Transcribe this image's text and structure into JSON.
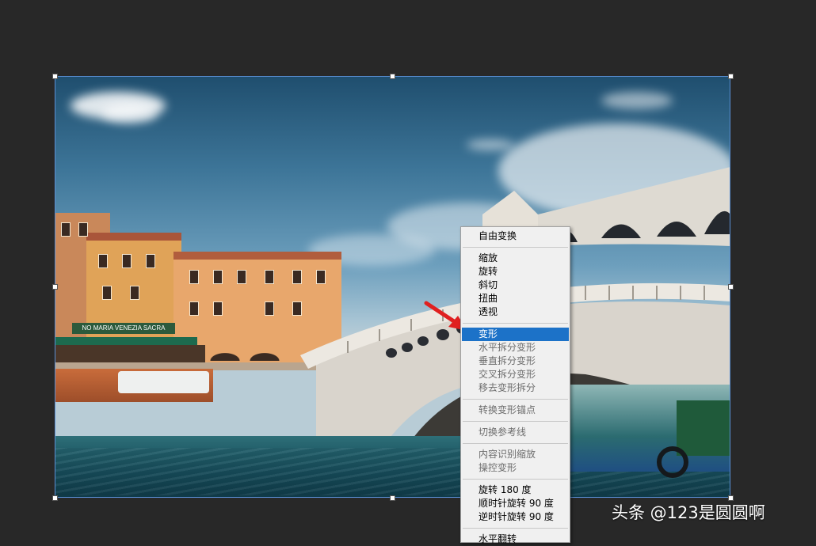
{
  "context_menu": {
    "items": [
      {
        "label": "自由变换",
        "state": "normal"
      },
      {
        "label": "缩放",
        "state": "normal"
      },
      {
        "label": "旋转",
        "state": "normal"
      },
      {
        "label": "斜切",
        "state": "normal"
      },
      {
        "label": "扭曲",
        "state": "normal"
      },
      {
        "label": "透视",
        "state": "normal"
      },
      {
        "label": "变形",
        "state": "selected"
      },
      {
        "label": "水平拆分变形",
        "state": "disabled"
      },
      {
        "label": "垂直拆分变形",
        "state": "disabled"
      },
      {
        "label": "交叉拆分变形",
        "state": "disabled"
      },
      {
        "label": "移去变形拆分",
        "state": "disabled"
      },
      {
        "label": "转换变形锚点",
        "state": "disabled"
      },
      {
        "label": "切换参考线",
        "state": "disabled"
      },
      {
        "label": "内容识别缩放",
        "state": "disabled"
      },
      {
        "label": "操控变形",
        "state": "disabled"
      },
      {
        "label": "旋转 180 度",
        "state": "normal"
      },
      {
        "label": "顺时针旋转 90 度",
        "state": "normal"
      },
      {
        "label": "逆时针旋转 90 度",
        "state": "normal"
      },
      {
        "label": "水平翻转",
        "state": "normal"
      }
    ],
    "selected_color": "#1c72c8"
  },
  "photo": {
    "shop_sign": "NO MARIA VENEZIA SACRA"
  },
  "annotation": {
    "arrow_color": "#e02020"
  },
  "watermark": {
    "text": "头条 @123是圆圆啊"
  },
  "colors": {
    "workspace_bg": "#282828",
    "bbox_border": "#5a8fd4"
  }
}
